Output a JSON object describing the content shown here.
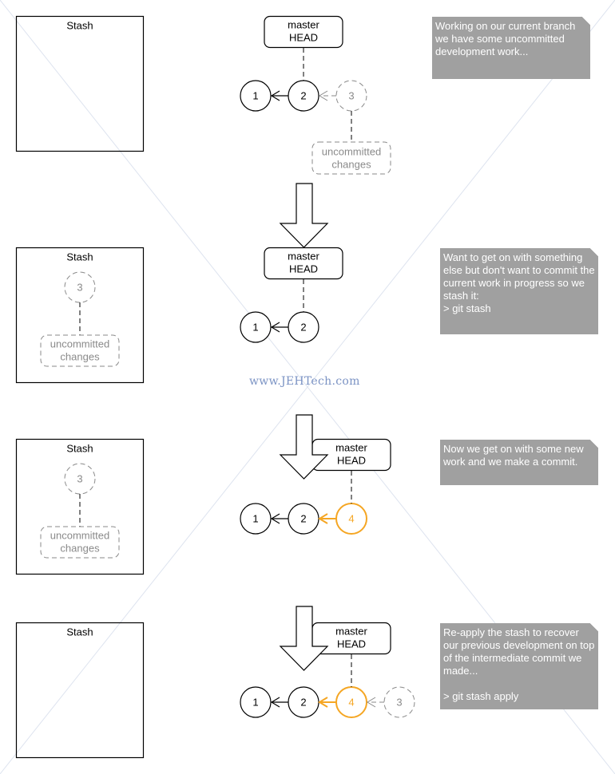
{
  "colors": {
    "ink": "#000000",
    "ghost": "#8a8a8a",
    "accent": "#f5a623",
    "note_bg": "#a0a0a0",
    "note_text": "#ffffff",
    "watermark": "#7b93c4"
  },
  "watermark": "www.JEHTech.com",
  "steps": [
    {
      "stash": {
        "title": "Stash",
        "items": []
      },
      "branch_label": [
        "master",
        "HEAD"
      ],
      "commits": [
        {
          "id": "1",
          "style": "normal"
        },
        {
          "id": "2",
          "style": "normal"
        },
        {
          "id": "3",
          "style": "ghost"
        }
      ],
      "head_on": "2",
      "uncommitted_on": "3",
      "uncommitted_label": [
        "uncommitted",
        "changes"
      ],
      "note": "Working on our current branch we have some uncommitted development work..."
    },
    {
      "stash": {
        "title": "Stash",
        "items": [
          {
            "id": "3",
            "label": [
              "uncommitted",
              "changes"
            ]
          }
        ]
      },
      "branch_label": [
        "master",
        "HEAD"
      ],
      "commits": [
        {
          "id": "1",
          "style": "normal"
        },
        {
          "id": "2",
          "style": "normal"
        }
      ],
      "head_on": "2",
      "note": "Want to get on with something else but don't want to commit the current work in progress so we stash it:\n> git stash"
    },
    {
      "stash": {
        "title": "Stash",
        "items": [
          {
            "id": "3",
            "label": [
              "uncommitted",
              "changes"
            ]
          }
        ]
      },
      "branch_label": [
        "master",
        "HEAD"
      ],
      "commits": [
        {
          "id": "1",
          "style": "normal"
        },
        {
          "id": "2",
          "style": "normal"
        },
        {
          "id": "4",
          "style": "accent"
        }
      ],
      "head_on": "4",
      "note": "Now we get on with some new work and we make a commit."
    },
    {
      "stash": {
        "title": "Stash",
        "items": []
      },
      "branch_label": [
        "master",
        "HEAD"
      ],
      "commits": [
        {
          "id": "1",
          "style": "normal"
        },
        {
          "id": "2",
          "style": "normal"
        },
        {
          "id": "4",
          "style": "accent"
        },
        {
          "id": "3",
          "style": "ghost"
        }
      ],
      "head_on": "4",
      "note": "Re-apply the stash to recover our previous development on top of the intermediate commit we made...\n\n> git stash apply"
    }
  ]
}
